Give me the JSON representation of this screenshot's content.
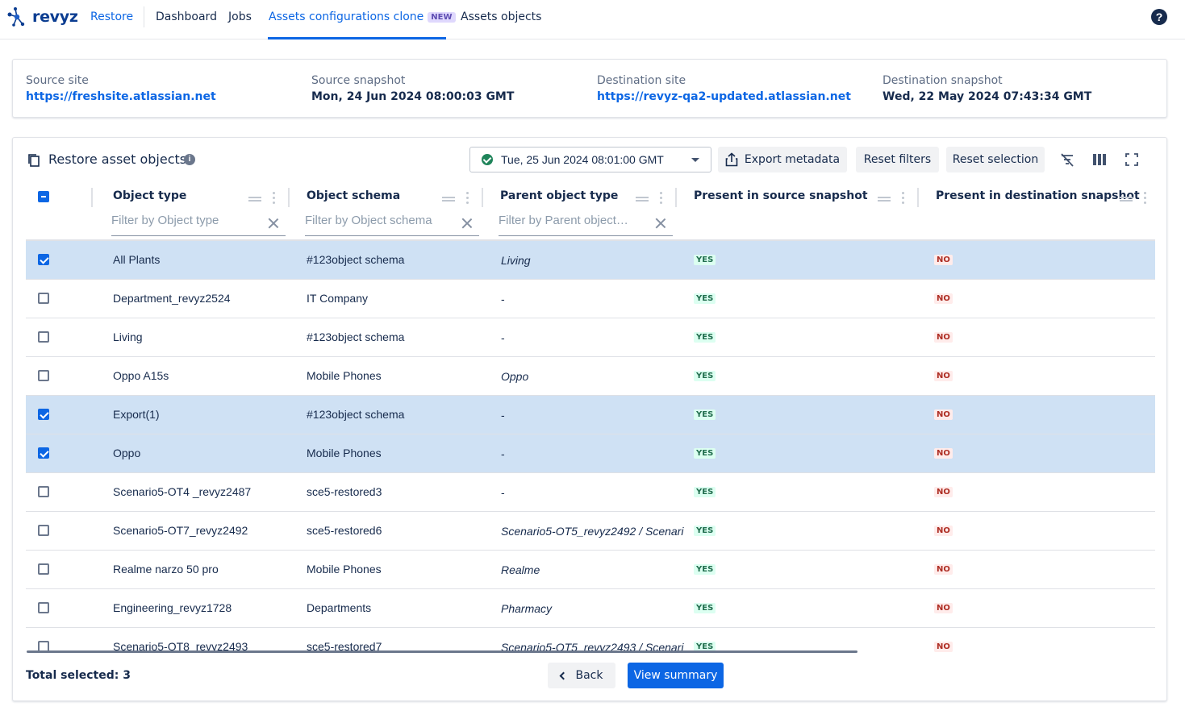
{
  "nav": {
    "brand": "revyz",
    "restore": "Restore",
    "dashboard": "Dashboard",
    "jobs": "Jobs",
    "assets_clone": "Assets configurations clone",
    "assets_clone_badge": "NEW",
    "assets_objects": "Assets objects",
    "help_icon": "?"
  },
  "sites": {
    "source_site_label": "Source site",
    "source_site_value": "https://freshsite.atlassian.net",
    "source_snapshot_label": "Source snapshot",
    "source_snapshot_value": "Mon, 24 Jun 2024 08:00:03 GMT",
    "dest_site_label": "Destination site",
    "dest_site_value": "https://revyz-qa2-updated.atlassian.net",
    "dest_snapshot_label": "Destination snapshot",
    "dest_snapshot_value": "Wed, 22 May 2024 07:43:34 GMT"
  },
  "panel": {
    "title": "Restore asset objects",
    "date_selected": "Tue, 25 Jun 2024 08:01:00 GMT",
    "export_label": "Export metadata",
    "reset_filters_label": "Reset filters",
    "reset_selection_label": "Reset selection",
    "icons": [
      "copy-icon",
      "info-icon",
      "check-circle-icon",
      "caret-down-icon",
      "export-icon",
      "clear-filter-icon",
      "columns-icon",
      "fullscreen-icon"
    ]
  },
  "table": {
    "columns": [
      "Object type",
      "Object schema",
      "Parent object type",
      "Present in source snapshot",
      "Present in destination snapshot"
    ],
    "filters": [
      "Filter by Object type",
      "Filter by Object schema",
      "Filter by Parent object…"
    ],
    "rows": [
      {
        "checked": true,
        "object_type": "All Plants",
        "schema": "#123object schema",
        "parent": "Living",
        "source": "YES",
        "dest": "NO"
      },
      {
        "checked": false,
        "object_type": "Department_revyz2524",
        "schema": "IT Company",
        "parent": "-",
        "source": "YES",
        "dest": "NO"
      },
      {
        "checked": false,
        "object_type": "Living",
        "schema": "#123object schema",
        "parent": "-",
        "source": "YES",
        "dest": "NO"
      },
      {
        "checked": false,
        "object_type": "Oppo A15s",
        "schema": "Mobile Phones",
        "parent": "Oppo",
        "source": "YES",
        "dest": "NO"
      },
      {
        "checked": true,
        "object_type": "Export(1)",
        "schema": "#123object schema",
        "parent": "-",
        "source": "YES",
        "dest": "NO"
      },
      {
        "checked": true,
        "object_type": "Oppo",
        "schema": "Mobile Phones",
        "parent": "-",
        "source": "YES",
        "dest": "NO"
      },
      {
        "checked": false,
        "object_type": "Scenario5-OT4 _revyz2487",
        "schema": "sce5-restored3",
        "parent": "-",
        "source": "YES",
        "dest": "NO"
      },
      {
        "checked": false,
        "object_type": "Scenario5-OT7_revyz2492",
        "schema": "sce5-restored6",
        "parent": "Scenario5-OT5_revyz2492 / Scenari",
        "source": "YES",
        "dest": "NO"
      },
      {
        "checked": false,
        "object_type": "Realme narzo 50 pro",
        "schema": "Mobile Phones",
        "parent": "Realme",
        "source": "YES",
        "dest": "NO"
      },
      {
        "checked": false,
        "object_type": "Engineering_revyz1728",
        "schema": "Departments",
        "parent": "Pharmacy",
        "source": "YES",
        "dest": "NO"
      },
      {
        "checked": false,
        "object_type": "Scenario5-OT8_revyz2493",
        "schema": "sce5-restored7",
        "parent": "Scenario5-OT5_revyz2493 / Scenari",
        "source": "YES",
        "dest": "NO"
      }
    ]
  },
  "footer": {
    "total_label": "Total selected:",
    "total_value": "3",
    "back_label": "Back",
    "summary_label": "View summary"
  },
  "colors": {
    "brand": "#0b3d91",
    "accent": "#0c66e4",
    "selected_row": "#cfe1f4",
    "yes": "#216e4e",
    "no": "#ae2e24"
  }
}
